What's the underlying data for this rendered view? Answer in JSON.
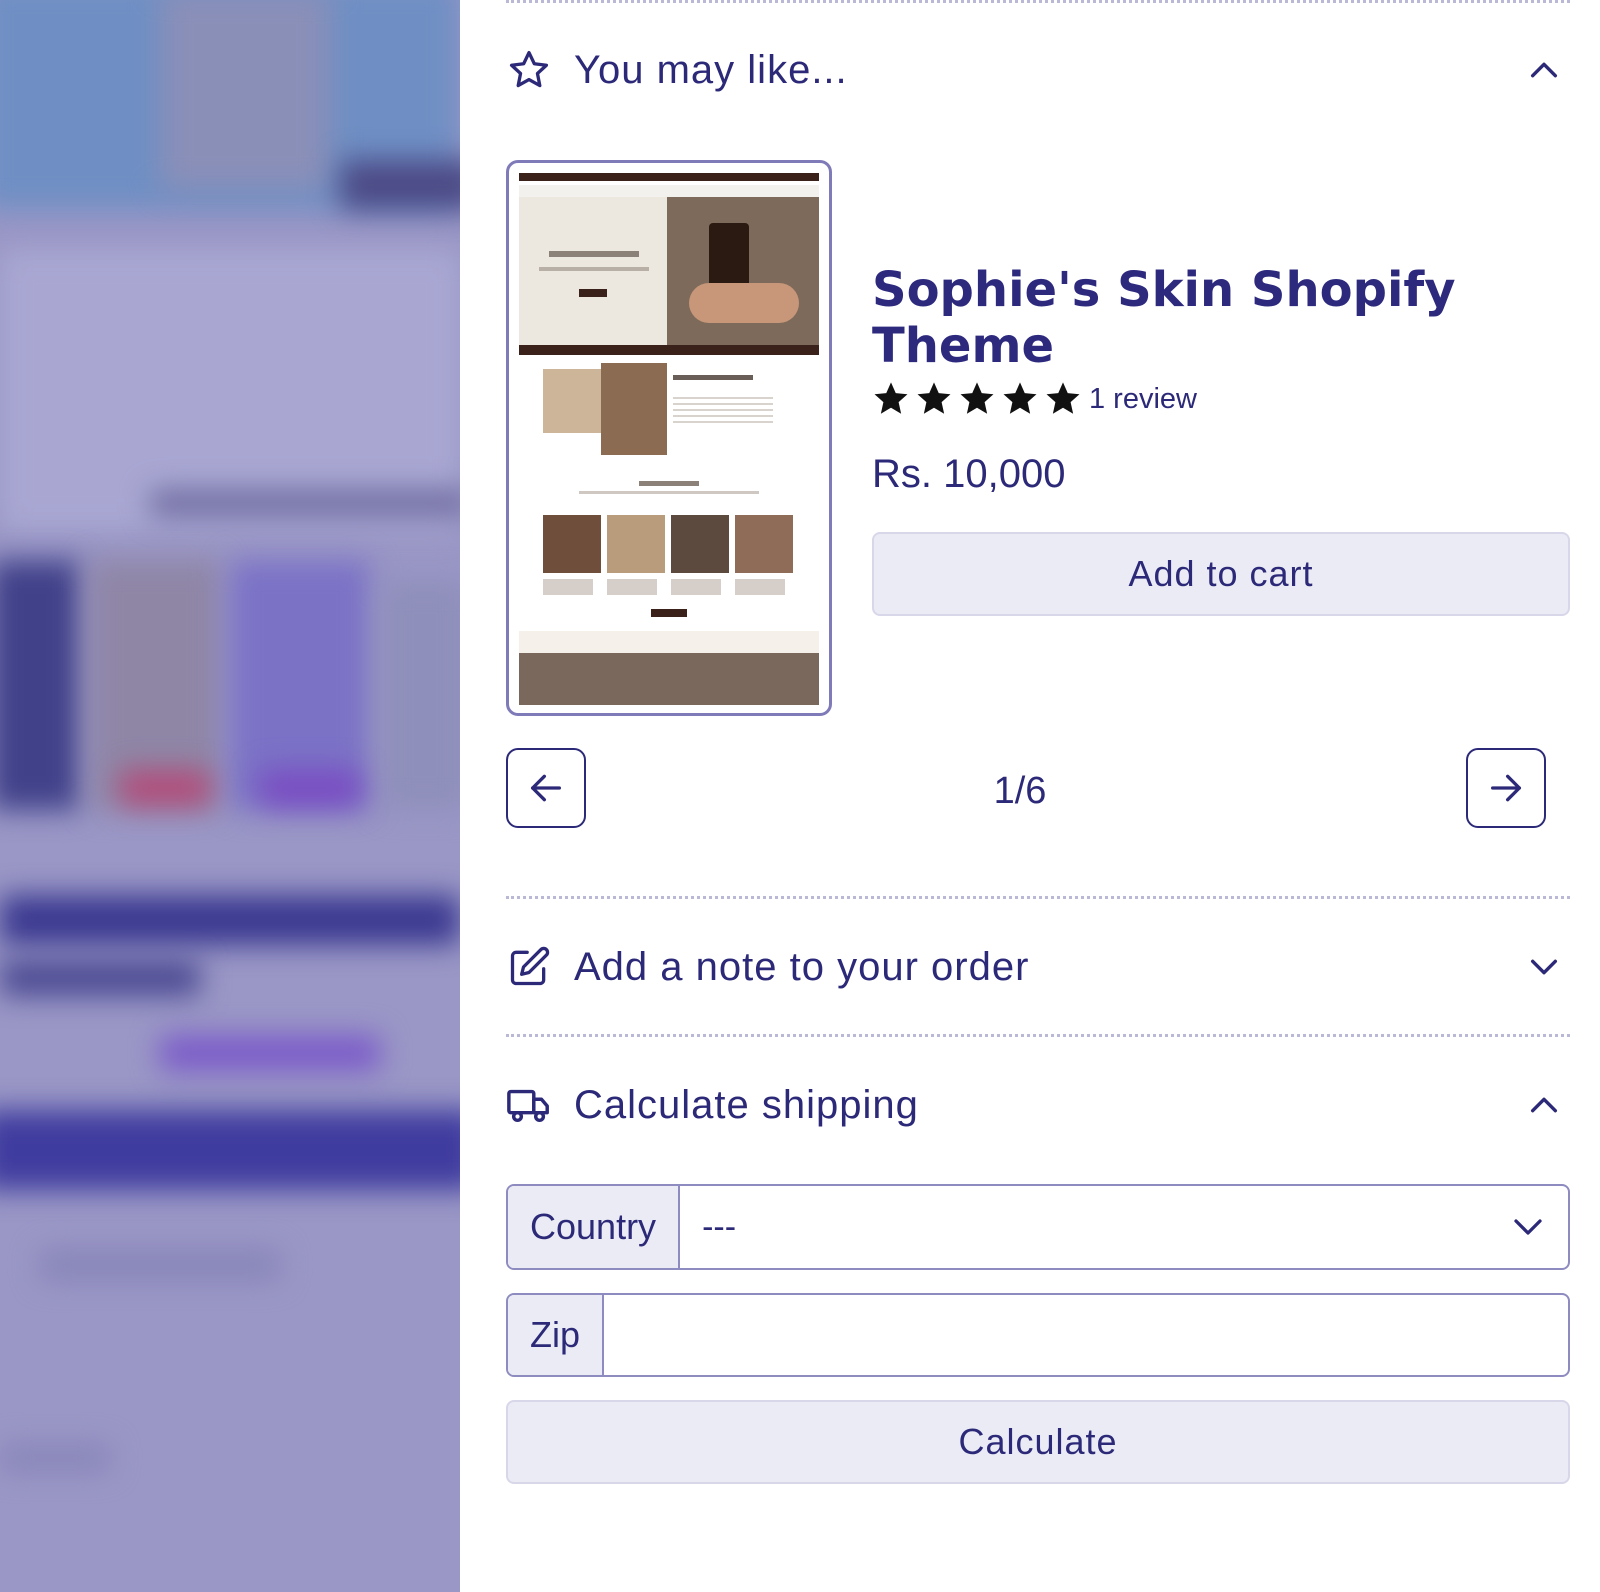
{
  "drawer": {
    "recommendations": {
      "title": "You may like...",
      "icon": "star-outline-icon",
      "expanded": true,
      "product": {
        "name": "Sophie's Skin Shopify Theme",
        "rating": 5,
        "rating_max": 5,
        "review_text": "1 review",
        "price": "Rs. 10,000",
        "add_to_cart_label": "Add to cart"
      },
      "pager": "1/6",
      "prev_icon": "arrow-left-icon",
      "next_icon": "arrow-right-icon"
    },
    "order_note": {
      "title": "Add a note to your order",
      "icon": "edit-note-icon",
      "expanded": false
    },
    "shipping": {
      "title": "Calculate shipping",
      "icon": "truck-icon",
      "expanded": true,
      "country_label": "Country",
      "country_value": "---",
      "zip_label": "Zip",
      "zip_value": "",
      "calculate_label": "Calculate"
    }
  },
  "colors": {
    "accent": "#2c2a78",
    "soft_button": "#ebebf5",
    "overlay": "#9a97c6"
  }
}
